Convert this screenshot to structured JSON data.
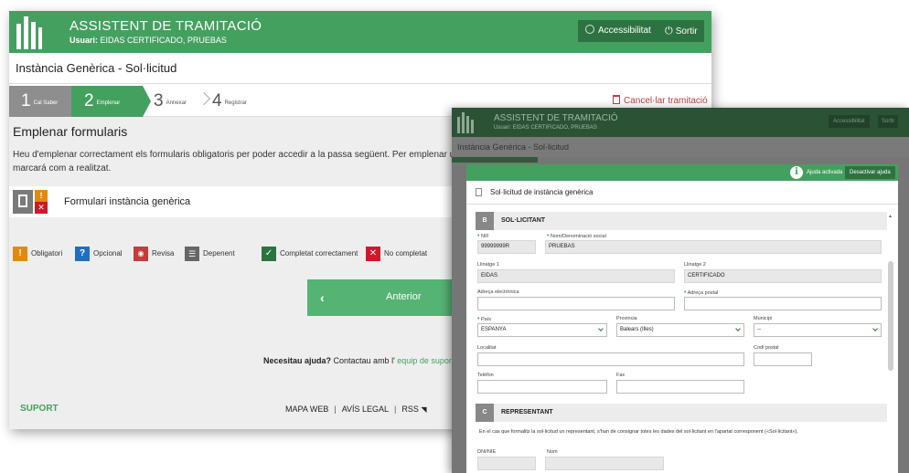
{
  "back": {
    "app_title": "ASSISTENT DE TRAMITACIÓ",
    "user_label": "Usuari:",
    "user_name": "EIDAS CERTIFICADO, PRUEBAS",
    "accessibility_label": "Accessibilitat",
    "logout_label": "Sortir",
    "page_title": "Instància Genèrica - Sol·licitud",
    "steps": [
      {
        "num": "1",
        "label": "Cal Saber"
      },
      {
        "num": "2",
        "label": "Emplenar"
      },
      {
        "num": "3",
        "label": "Annexar"
      },
      {
        "num": "4",
        "label": "Registrar"
      }
    ],
    "cancel_label": "Cancel·lar tramitació",
    "section_title": "Emplenar formularis",
    "section_text": "Heu d'emplenar correctament els formularis obligatoris per poder accedir a la passa següent. Per emplenar u",
    "section_text2": "marcará com a realitzat.",
    "form_name": "Formulari instància genèrica",
    "legend": {
      "mandatory": "Obligatori",
      "optional": "Opcional",
      "review": "Revisa",
      "dependent": "Depenent",
      "completed": "Completat correctament",
      "not_completed": "No completat"
    },
    "prev_button": "Anterior",
    "help_bold": "Necesitau ajuda?",
    "help_text": " Contactau amb l'",
    "help_link": " equip de supor",
    "support": "SUPORT",
    "footer": {
      "map": "MAPA WEB",
      "legal": "AVÍS LEGAL",
      "rss": "RSS"
    }
  },
  "front": {
    "app_title": "ASSISTENT DE TRAMITACIÓ",
    "user_line": "Usuari: EIDAS CERTIFICADO, PRUEBAS",
    "accessibility_label": "Accessibilitat",
    "logout_label": "Sortir",
    "page_title": "Instància Genèrica - Sol·licitud",
    "help_active": "Ajuda activada",
    "disable_help": "Desactivar ajuda",
    "modal_title": "Sol·licitud de instància genèrica",
    "section_b": {
      "letter": "B",
      "name": "SOL·LICITANT"
    },
    "section_c": {
      "letter": "C",
      "name": "REPRESENTANT"
    },
    "fields": {
      "nif_label": "NIF",
      "nif_value": "99999999R",
      "name_label": "Nom/Denominació social",
      "name_value": "PRUEBAS",
      "surname1_label": "Llinatge 1",
      "surname1_value": "EIDAS",
      "surname2_label": "Llinatge 2",
      "surname2_value": "CERTIFICADO",
      "email_label": "Adreça electrònica",
      "address_label": "Adreça postal",
      "country_label": "País",
      "country_value": "ESPANYA",
      "province_label": "Provincia",
      "province_value": "Balears (Illes)",
      "municipality_label": "Municipi",
      "municipality_value": "--",
      "locality_label": "Localitat",
      "postal_label": "Codi postal",
      "phone_label": "Telèfon",
      "fax_label": "Fax",
      "dni_label": "DNI/NIE",
      "nom_label": "Nom"
    },
    "rep_note": "En el cas que formalitz la sol·licitud un representant, s'han de consignar totes les dades del sol·licitant en l'apartat corresponent («Sol·licitant»)."
  },
  "colors": {
    "brand_green": "#44a05f",
    "dark_green": "#2d7341",
    "danger": "#c43c3c",
    "warning": "#e28a10",
    "info": "#1f6fbf"
  }
}
